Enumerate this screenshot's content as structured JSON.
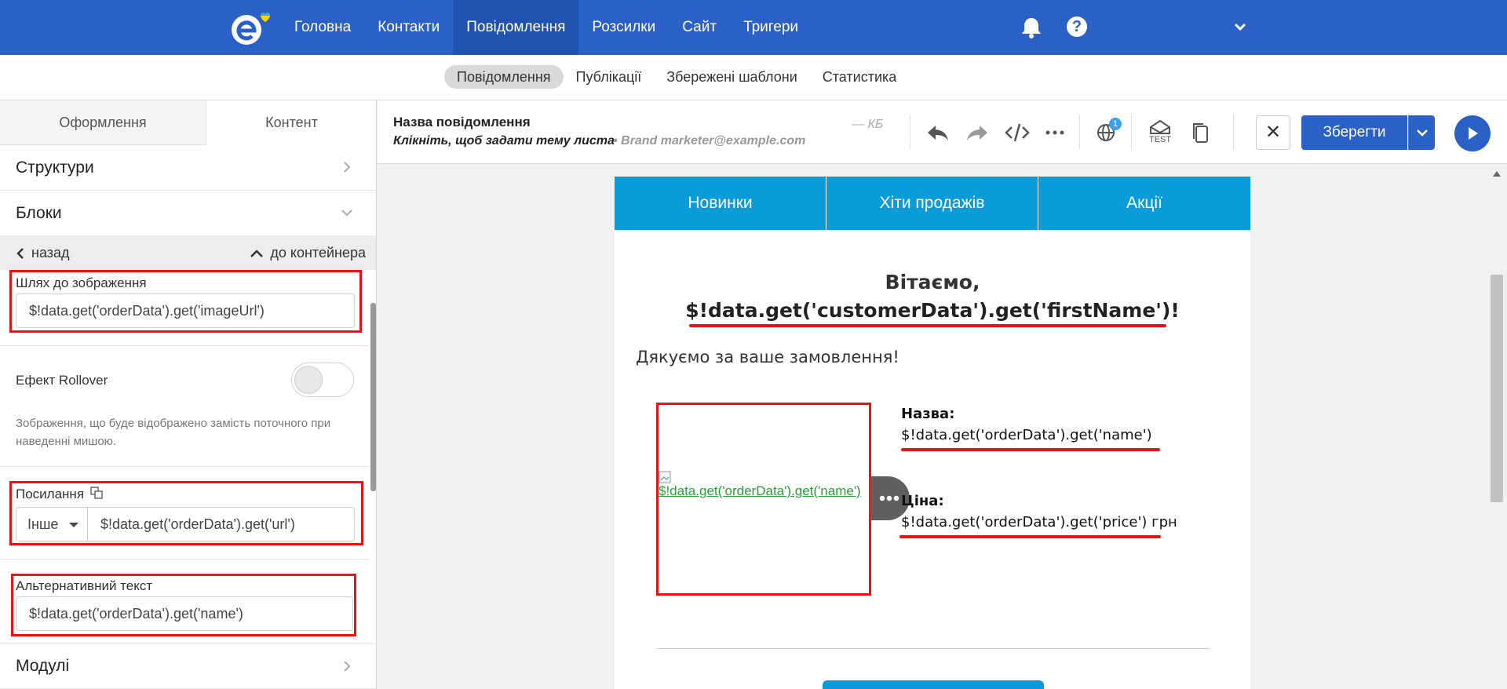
{
  "nav": {
    "items": [
      "Головна",
      "Контакти",
      "Повідомлення",
      "Розсилки",
      "Сайт",
      "Тригери"
    ],
    "active_index": 2,
    "help_label": "?"
  },
  "subnav": {
    "items": [
      "Повідомлення",
      "Публікації",
      "Збережені шаблони",
      "Статистика"
    ],
    "active_index": 0
  },
  "left_panel": {
    "tabs": [
      "Оформлення",
      "Контент"
    ],
    "active_tab": 1,
    "sections": {
      "structures": "Структури",
      "blocks": "Блоки",
      "modules": "Модулі"
    },
    "back_label": "назад",
    "up_label": "до контейнера",
    "image_path": {
      "label": "Шлях до зображення",
      "value": "$!data.get('orderData').get('imageUrl')"
    },
    "rollover": {
      "label": "Ефект Rollover",
      "enabled": false,
      "hint": "Зображення, що буде відображено замість поточного при наведенні мишою."
    },
    "link": {
      "label": "Посилання",
      "type": "Інше",
      "value": "$!data.get('orderData').get('url')"
    },
    "alt_text": {
      "label": "Альтернативний текст",
      "value": "$!data.get('orderData').get('name')"
    }
  },
  "editor_header": {
    "message_name": "Назва повідомлення",
    "subject_placeholder": "Клікніть, щоб задати тему листа",
    "sender": "• Brand marketer@example.com",
    "size": "— КБ",
    "notification_count": "1",
    "test_label": "TEST",
    "close_label": "✕",
    "save_label": "Зберегти"
  },
  "email": {
    "menu": [
      "Новинки",
      "Хіти продажів",
      "Акції"
    ],
    "greeting": "Вітаємо,",
    "greeting_name": "$!data.get('customerData').get('firstName')!",
    "thanks": "Дякуємо за ваше замовлення!",
    "image_alt_link": "$!data.get('orderData').get('name')",
    "name_label": "Назва:",
    "name_value": "$!data.get('orderData').get('name')",
    "price_label": "Ціна:",
    "price_value": "$!data.get('orderData').get('price') грн"
  },
  "colors": {
    "nav_bg": "#2b60c6",
    "email_menu_bg": "#099cd8",
    "highlight": "#ee1111",
    "link_green": "#2e9b3d"
  }
}
